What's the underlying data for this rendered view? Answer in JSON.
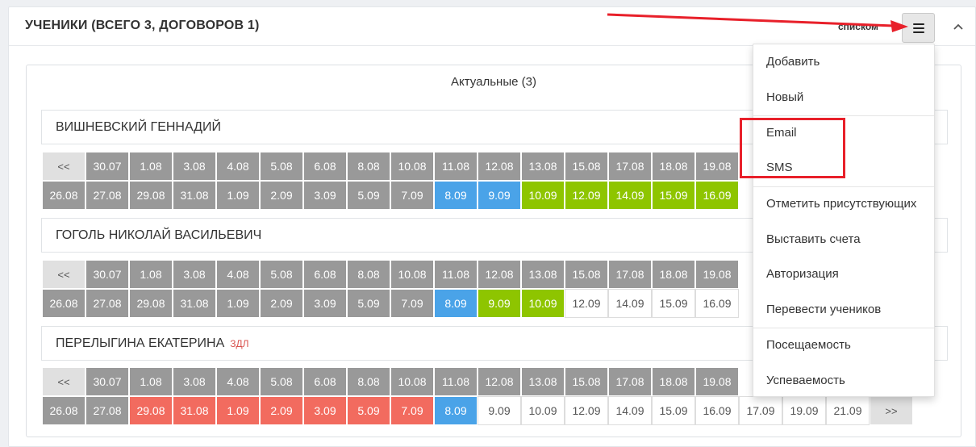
{
  "header": {
    "title": "УЧЕНИКИ (ВСЕГО 3, ДОГОВОРОВ 1)",
    "view_label": "списком"
  },
  "section": {
    "title": "Актуальные (3)"
  },
  "nav": {
    "prev": "<<",
    "next": ">>"
  },
  "students": [
    {
      "name": "ВИШНЕВСКИЙ ГЕННАДИЙ",
      "badge": "",
      "row1": [
        {
          "d": "<<",
          "s": "nav"
        },
        {
          "d": "30.07",
          "s": "gray"
        },
        {
          "d": "1.08",
          "s": "gray"
        },
        {
          "d": "3.08",
          "s": "gray"
        },
        {
          "d": "4.08",
          "s": "gray"
        },
        {
          "d": "5.08",
          "s": "gray"
        },
        {
          "d": "6.08",
          "s": "gray"
        },
        {
          "d": "8.08",
          "s": "gray"
        },
        {
          "d": "10.08",
          "s": "gray"
        },
        {
          "d": "11.08",
          "s": "gray"
        },
        {
          "d": "12.08",
          "s": "gray"
        },
        {
          "d": "13.08",
          "s": "gray"
        },
        {
          "d": "15.08",
          "s": "gray"
        },
        {
          "d": "17.08",
          "s": "gray"
        },
        {
          "d": "18.08",
          "s": "gray"
        },
        {
          "d": "19.08",
          "s": "gray"
        }
      ],
      "row2": [
        {
          "d": "26.08",
          "s": "gray"
        },
        {
          "d": "27.08",
          "s": "gray"
        },
        {
          "d": "29.08",
          "s": "gray"
        },
        {
          "d": "31.08",
          "s": "gray"
        },
        {
          "d": "1.09",
          "s": "gray"
        },
        {
          "d": "2.09",
          "s": "gray"
        },
        {
          "d": "3.09",
          "s": "gray"
        },
        {
          "d": "5.09",
          "s": "gray"
        },
        {
          "d": "7.09",
          "s": "gray"
        },
        {
          "d": "8.09",
          "s": "blue"
        },
        {
          "d": "9.09",
          "s": "blue"
        },
        {
          "d": "10.09",
          "s": "green"
        },
        {
          "d": "12.09",
          "s": "green"
        },
        {
          "d": "14.09",
          "s": "green"
        },
        {
          "d": "15.09",
          "s": "green"
        },
        {
          "d": "16.09",
          "s": "green"
        }
      ]
    },
    {
      "name": "ГОГОЛЬ НИКОЛАЙ ВАСИЛЬЕВИЧ",
      "badge": "",
      "row1": [
        {
          "d": "<<",
          "s": "nav"
        },
        {
          "d": "30.07",
          "s": "gray"
        },
        {
          "d": "1.08",
          "s": "gray"
        },
        {
          "d": "3.08",
          "s": "gray"
        },
        {
          "d": "4.08",
          "s": "gray"
        },
        {
          "d": "5.08",
          "s": "gray"
        },
        {
          "d": "6.08",
          "s": "gray"
        },
        {
          "d": "8.08",
          "s": "gray"
        },
        {
          "d": "10.08",
          "s": "gray"
        },
        {
          "d": "11.08",
          "s": "gray"
        },
        {
          "d": "12.08",
          "s": "gray"
        },
        {
          "d": "13.08",
          "s": "gray"
        },
        {
          "d": "15.08",
          "s": "gray"
        },
        {
          "d": "17.08",
          "s": "gray"
        },
        {
          "d": "18.08",
          "s": "gray"
        },
        {
          "d": "19.08",
          "s": "gray"
        }
      ],
      "row2": [
        {
          "d": "26.08",
          "s": "gray"
        },
        {
          "d": "27.08",
          "s": "gray"
        },
        {
          "d": "29.08",
          "s": "gray"
        },
        {
          "d": "31.08",
          "s": "gray"
        },
        {
          "d": "1.09",
          "s": "gray"
        },
        {
          "d": "2.09",
          "s": "gray"
        },
        {
          "d": "3.09",
          "s": "gray"
        },
        {
          "d": "5.09",
          "s": "gray"
        },
        {
          "d": "7.09",
          "s": "gray"
        },
        {
          "d": "8.09",
          "s": "blue"
        },
        {
          "d": "9.09",
          "s": "green"
        },
        {
          "d": "10.09",
          "s": "green"
        },
        {
          "d": "12.09",
          "s": "white"
        },
        {
          "d": "14.09",
          "s": "white"
        },
        {
          "d": "15.09",
          "s": "white"
        },
        {
          "d": "16.09",
          "s": "white"
        }
      ]
    },
    {
      "name": "ПЕРЕЛЫГИНА ЕКАТЕРИНА",
      "badge": "ЗДЛ",
      "row1": [
        {
          "d": "<<",
          "s": "nav"
        },
        {
          "d": "30.07",
          "s": "gray"
        },
        {
          "d": "1.08",
          "s": "gray"
        },
        {
          "d": "3.08",
          "s": "gray"
        },
        {
          "d": "4.08",
          "s": "gray"
        },
        {
          "d": "5.08",
          "s": "gray"
        },
        {
          "d": "6.08",
          "s": "gray"
        },
        {
          "d": "8.08",
          "s": "gray"
        },
        {
          "d": "10.08",
          "s": "gray"
        },
        {
          "d": "11.08",
          "s": "gray"
        },
        {
          "d": "12.08",
          "s": "gray"
        },
        {
          "d": "13.08",
          "s": "gray"
        },
        {
          "d": "15.08",
          "s": "gray"
        },
        {
          "d": "17.08",
          "s": "gray"
        },
        {
          "d": "18.08",
          "s": "gray"
        },
        {
          "d": "19.08",
          "s": "gray"
        }
      ],
      "row2": [
        {
          "d": "26.08",
          "s": "gray"
        },
        {
          "d": "27.08",
          "s": "gray"
        },
        {
          "d": "29.08",
          "s": "red"
        },
        {
          "d": "31.08",
          "s": "red"
        },
        {
          "d": "1.09",
          "s": "red"
        },
        {
          "d": "2.09",
          "s": "red"
        },
        {
          "d": "3.09",
          "s": "red"
        },
        {
          "d": "5.09",
          "s": "red"
        },
        {
          "d": "7.09",
          "s": "red"
        },
        {
          "d": "8.09",
          "s": "blue"
        },
        {
          "d": "9.09",
          "s": "white"
        },
        {
          "d": "10.09",
          "s": "white"
        },
        {
          "d": "12.09",
          "s": "white"
        },
        {
          "d": "14.09",
          "s": "white"
        },
        {
          "d": "15.09",
          "s": "white"
        },
        {
          "d": "16.09",
          "s": "white"
        },
        {
          "d": "17.09",
          "s": "white"
        },
        {
          "d": "19.09",
          "s": "white"
        },
        {
          "d": "21.09",
          "s": "white"
        },
        {
          "d": ">>",
          "s": "nav"
        }
      ]
    }
  ],
  "dropdown": {
    "items": [
      "Добавить",
      "Новый",
      "Email",
      "SMS",
      "Отметить присутствующих",
      "Выставить счета",
      "Авторизация",
      "Перевести учеников",
      "Посещаемость",
      "Успеваемость"
    ]
  },
  "colors": {
    "gray": "#999999",
    "blue": "#4aa3e8",
    "green": "#8ec500",
    "red": "#f26b5f",
    "annotation": "#e8202a"
  },
  "icons": {
    "menu": "hamburger-icon",
    "collapse": "chevron-up-icon"
  }
}
